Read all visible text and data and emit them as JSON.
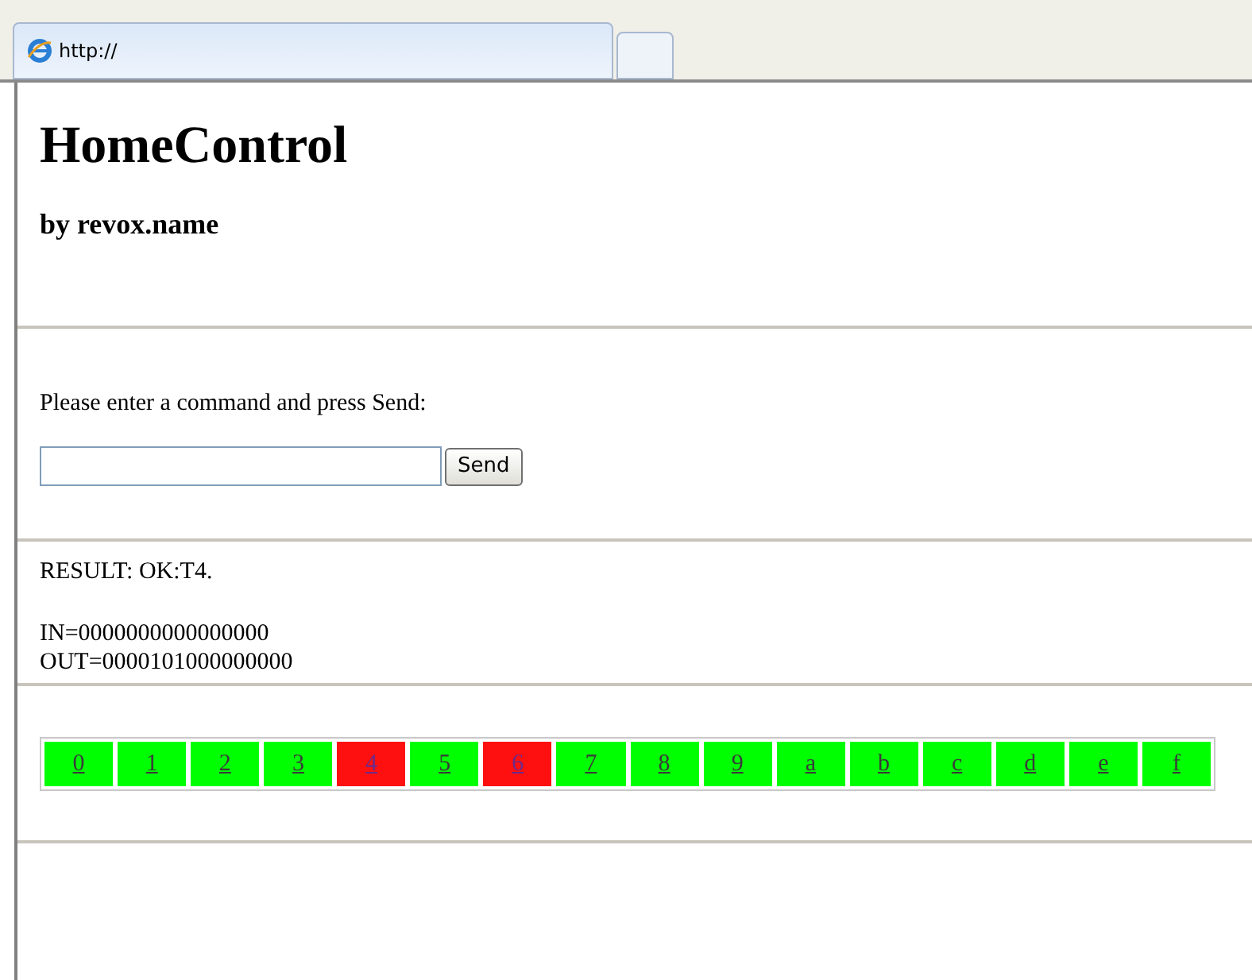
{
  "tabs": [
    {
      "label": "http://",
      "selected": true
    },
    {
      "selected": false
    }
  ],
  "page": {
    "title": "HomeControl",
    "subtitle": "by revox.name",
    "prompt": "Please enter a command and press Send:",
    "send_button": "Send",
    "result": "RESULT: OK:T4.",
    "inputs": "IN=0000000000000000",
    "outputs": "OUT=0000101000000000",
    "channels": [
      {
        "label": "0",
        "on": false
      },
      {
        "label": "1",
        "on": false
      },
      {
        "label": "2",
        "on": false
      },
      {
        "label": "3",
        "on": false
      },
      {
        "label": "4",
        "on": true
      },
      {
        "label": "5",
        "on": false
      },
      {
        "label": "6",
        "on": true
      },
      {
        "label": "7",
        "on": false
      },
      {
        "label": "8",
        "on": false
      },
      {
        "label": "9",
        "on": false
      },
      {
        "label": "a",
        "on": false
      },
      {
        "label": "b",
        "on": false
      },
      {
        "label": "c",
        "on": false
      },
      {
        "label": "d",
        "on": false
      },
      {
        "label": "e",
        "on": false
      },
      {
        "label": "f",
        "on": false
      }
    ]
  }
}
